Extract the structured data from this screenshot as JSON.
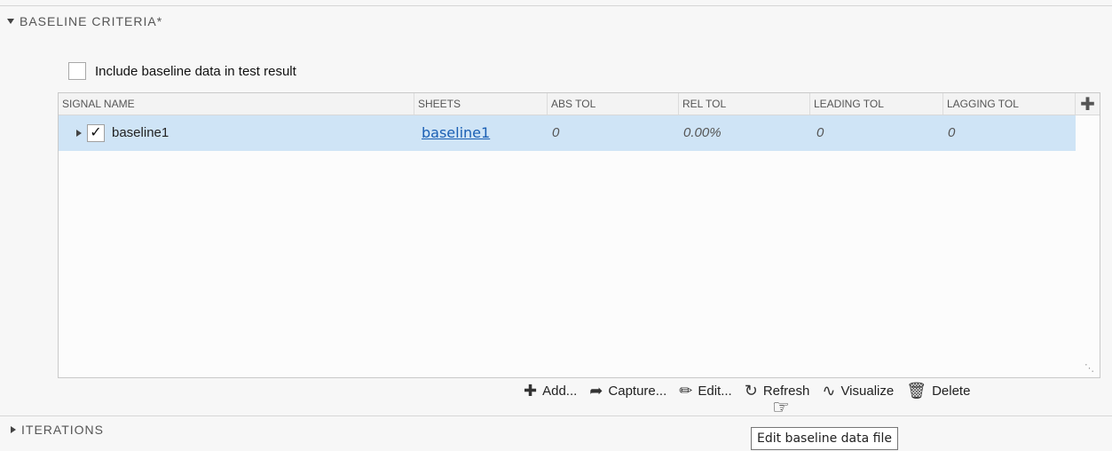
{
  "section": {
    "title": "BASELINE CRITERIA*",
    "collapsed": false
  },
  "include_checkbox": {
    "label": "Include baseline data in test result",
    "checked": false
  },
  "table": {
    "columns": [
      "SIGNAL NAME",
      "SHEETS",
      "ABS TOL",
      "REL TOL",
      "LEADING TOL",
      "LAGGING TOL"
    ],
    "add_column_icon": "plus-icon",
    "rows": [
      {
        "signal_name": "baseline1",
        "checked": true,
        "sheets": "baseline1",
        "abs_tol": "0",
        "rel_tol": "0.00%",
        "leading_tol": "0",
        "lagging_tol": "0"
      }
    ]
  },
  "toolbar": {
    "add": "Add...",
    "capture": "Capture...",
    "edit": "Edit...",
    "refresh": "Refresh",
    "visualize": "Visualize",
    "delete": "Delete"
  },
  "iterations": {
    "title": "ITERATIONS",
    "collapsed": true
  },
  "tooltip": {
    "text": "Edit baseline data file"
  },
  "colors": {
    "selected_row": "#cfe4f6",
    "link": "#1a5fb4"
  }
}
